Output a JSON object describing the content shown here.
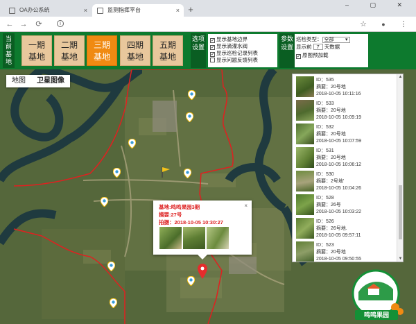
{
  "browser": {
    "tabs": [
      {
        "title": "OA办公系统",
        "active": false
      },
      {
        "title": "监测指挥平台",
        "active": true
      }
    ],
    "new_tab_symbol": "+",
    "close_symbol": "×",
    "back_symbol": "←",
    "forward_symbol": "→",
    "reload_symbol": "⟳",
    "info_symbol": "i",
    "star_symbol": "☆",
    "account_symbol": "●",
    "menu_symbol": "⋮",
    "window_controls": "–  ▢  ✕"
  },
  "header": {
    "current_base_label": "当前基地",
    "bases": [
      {
        "line1": "一期",
        "line2": "基地",
        "active": false
      },
      {
        "line1": "二期",
        "line2": "基地",
        "active": false
      },
      {
        "line1": "三期",
        "line2": "基地",
        "active": true
      },
      {
        "line1": "四期",
        "line2": "基地",
        "active": false
      },
      {
        "line1": "五期",
        "line2": "基地",
        "active": false
      }
    ],
    "options_label": "选项设置",
    "options": [
      {
        "label": "显示基地边界",
        "checked": true
      },
      {
        "label": "显示滴灌水阀",
        "checked": true
      },
      {
        "label": "显示巡检记录列表",
        "checked": true
      },
      {
        "label": "显示问题反馈列表",
        "checked": false
      }
    ],
    "params_label": "参数设置",
    "params": {
      "inspect_type_label": "巡检类型：",
      "inspect_type_value": "全部",
      "show_prefix": "显示前",
      "days_value": "7",
      "days_suffix": "天数据",
      "preload_label": "原图预加载",
      "preload_checked": true,
      "check_mark": "✓"
    }
  },
  "map": {
    "map_types": [
      {
        "label": "地图",
        "active": false
      },
      {
        "label": "卫星图像",
        "active": true
      }
    ],
    "popup": {
      "base_line": "基地:鸣鸣果园3期",
      "summary_line": "摘要:27号",
      "time_line": "拍摄：2018-10-05 10:30:27",
      "close_symbol": "×"
    },
    "records": [
      {
        "id": "ID：535",
        "summary": "摘要：20号地",
        "time": "2018-10-05 10:11:16"
      },
      {
        "id": "ID：533",
        "summary": "摘要：20号地",
        "time": "2018-10-05 10:09:19"
      },
      {
        "id": "ID：532",
        "summary": "摘要：20号地",
        "time": "2018-10-05 10:07:59"
      },
      {
        "id": "ID：531",
        "summary": "摘要：20号地",
        "time": "2018-10-05 10:06:12"
      },
      {
        "id": "ID：530",
        "summary": "摘要：2号地'",
        "time": "2018-10-05 10:04:26"
      },
      {
        "id": "ID：528",
        "summary": "摘要：26号",
        "time": "2018-10-05 10:03:22"
      },
      {
        "id": "ID：526",
        "summary": "摘要：26号地.",
        "time": "2018-10-05 09:57:11"
      },
      {
        "id": "ID：523",
        "summary": "摘要：20号地",
        "time": "2018-10-05 09:50:55"
      }
    ],
    "scroll_up": "▲",
    "scroll_down": "▼",
    "logo_text": "鸣鸣果园",
    "colors": {
      "boundary": "#e02020",
      "header_green": "#0d7a2e",
      "active_base": "#f08a12",
      "base_tan": "#e8c79c"
    }
  }
}
